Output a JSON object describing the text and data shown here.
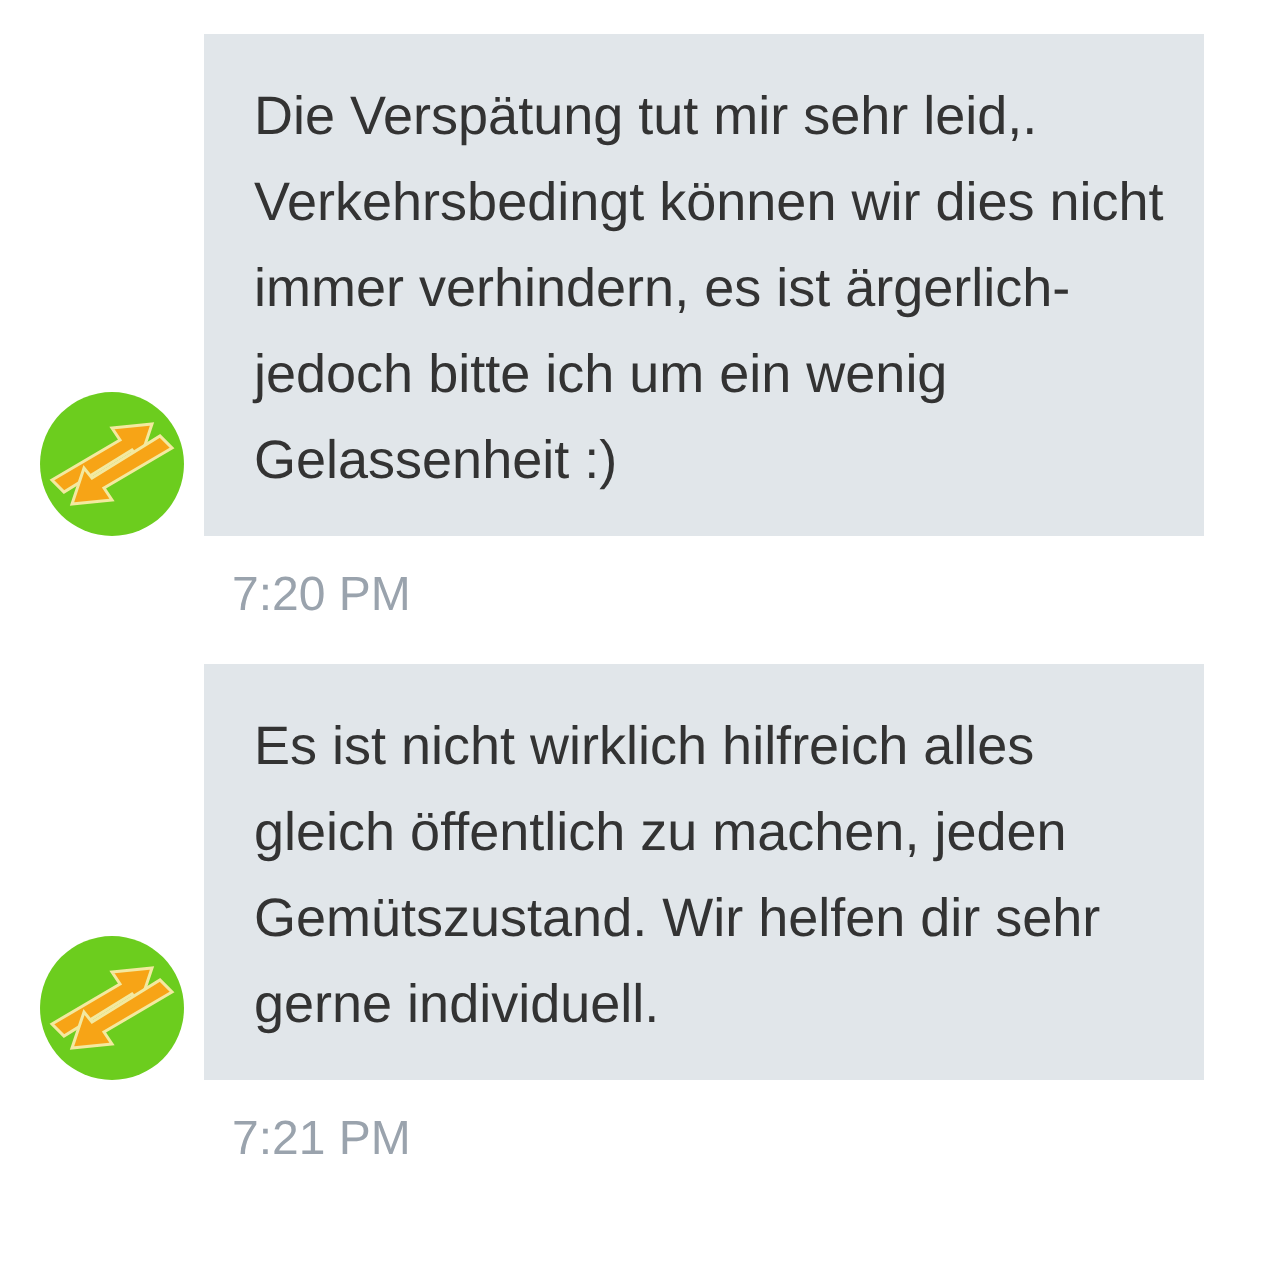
{
  "messages": [
    {
      "text": "Die Verspätung tut mir sehr leid,. Verkehrsbedingt können wir dies nicht immer verhindern, es ist ärgerlich- jedoch bitte ich um ein wenig Gelassenheit :)",
      "time": "7:20 PM"
    },
    {
      "text": "Es ist nicht wirklich hilfreich alles gleich öffentlich zu machen, jeden Gemütszustand. Wir helfen dir sehr gerne individuell.",
      "time": "7:21 PM"
    }
  ]
}
